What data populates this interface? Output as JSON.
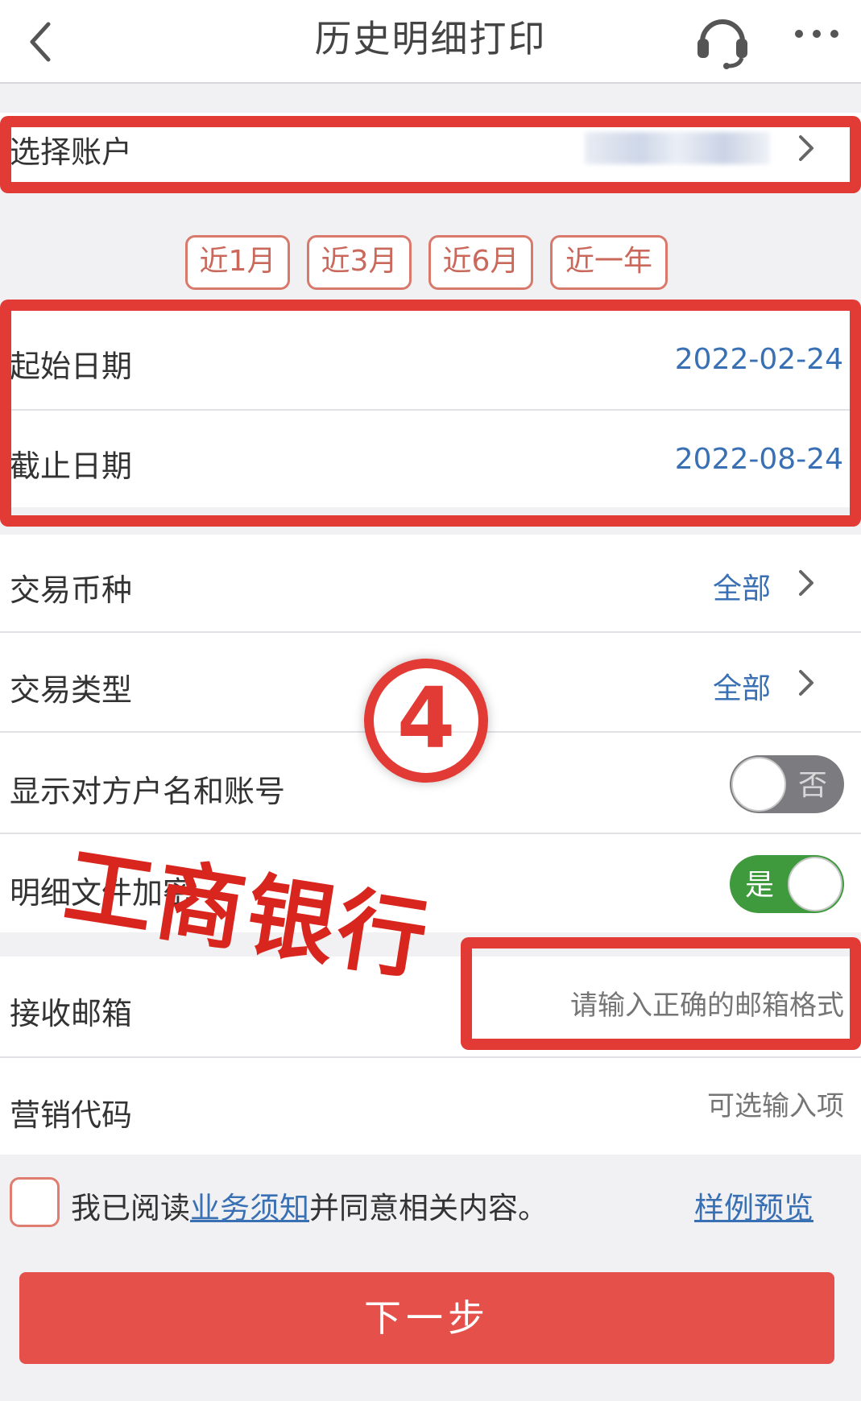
{
  "header": {
    "title": "历史明细打印",
    "back_icon": "chevron-left-icon",
    "support_icon": "headset-icon",
    "more_icon": "more-dots-icon"
  },
  "account": {
    "label": "选择账户",
    "value": "",
    "chevron_icon": "chevron-right-icon"
  },
  "quick_ranges": [
    "近1月",
    "近3月",
    "近6月",
    "近一年"
  ],
  "dates": {
    "start_label": "起始日期",
    "start_value": "2022-02-24",
    "end_label": "截止日期",
    "end_value": "2022-08-24"
  },
  "currency": {
    "label": "交易币种",
    "value": "全部"
  },
  "tx_type": {
    "label": "交易类型",
    "value": "全部"
  },
  "show_counterparty": {
    "label": "显示对方户名和账号",
    "toggle_text": "否",
    "on": false
  },
  "encrypt": {
    "label": "明细文件加密",
    "toggle_text": "是",
    "on": true
  },
  "email": {
    "label": "接收邮箱",
    "placeholder": "请输入正确的邮箱格式"
  },
  "marketing": {
    "label": "营销代码",
    "placeholder": "可选输入项"
  },
  "agreement": {
    "prefix": "我已阅读",
    "link": "业务须知",
    "suffix": "并同意相关内容。",
    "preview_link": "样例预览"
  },
  "next_button": "下一步",
  "annotations": {
    "step_badge": "4",
    "watermark": "工商银行"
  },
  "colors": {
    "accent_red": "#e5504a",
    "annotation_red": "#e23a34",
    "link_blue": "#3970b4",
    "toggle_green": "#3f9a3d"
  }
}
